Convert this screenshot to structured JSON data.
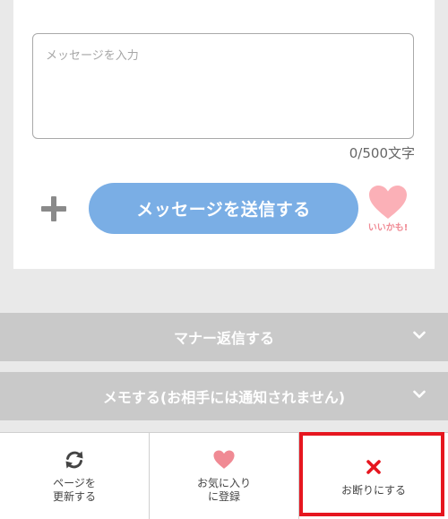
{
  "composer": {
    "placeholder": "メッセージを入力",
    "counter": "0/500文字",
    "send_label": "メッセージを送信する",
    "like_label": "いいかも!"
  },
  "accordions": [
    {
      "label": "マナー返信する"
    },
    {
      "label": "メモする(お相手には通知されません)"
    }
  ],
  "bottom_bar": {
    "refresh_line1": "ページを",
    "refresh_line2": "更新する",
    "favorite_line1": "お気に入り",
    "favorite_line2": "に登録",
    "decline_label": "お断りにする"
  },
  "colors": {
    "send_button": "#7aaee5",
    "heart": "#fbb0b7",
    "favorite_heart": "#f08a94",
    "decline_x": "#e6161f",
    "highlight_border": "#e6161f"
  },
  "icons": {
    "add": "plus-icon",
    "like": "heart-icon",
    "accordion_toggle": "chevron-down-icon",
    "refresh": "refresh-icon",
    "favorite": "heart-icon",
    "decline": "close-icon"
  }
}
